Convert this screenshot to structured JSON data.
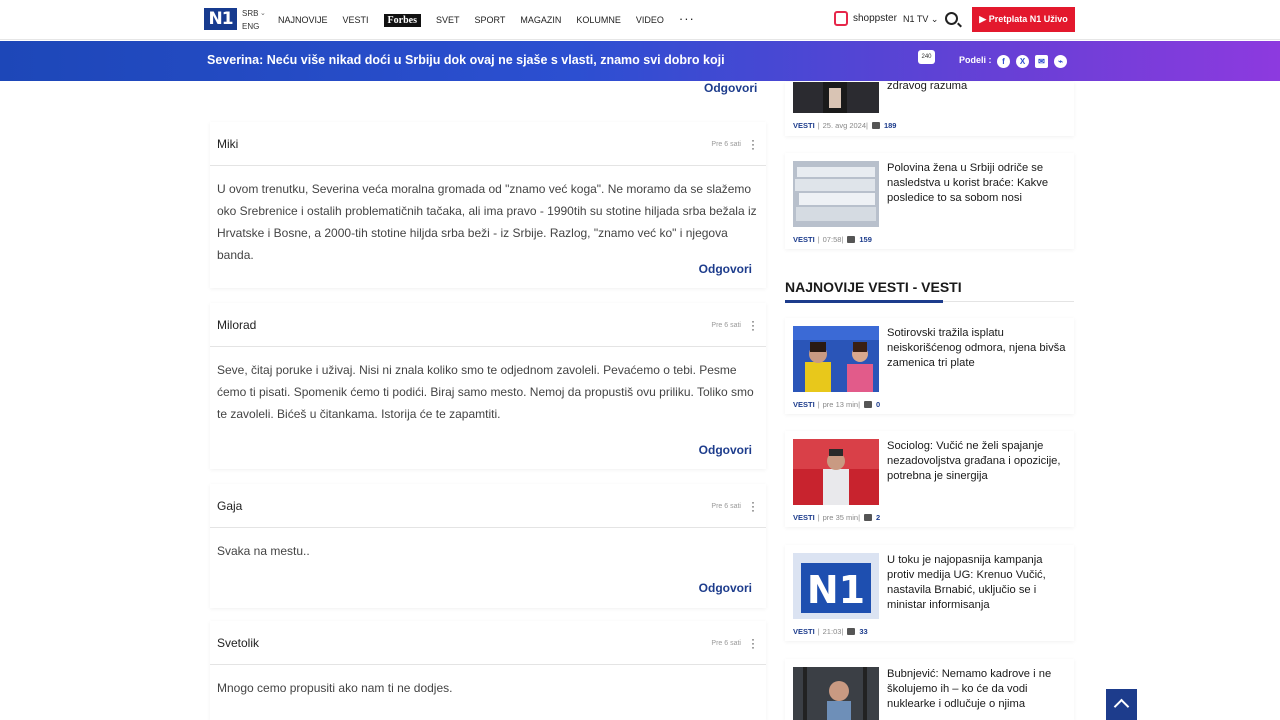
{
  "nav": {
    "logo": "N1",
    "lang_active": "SRB",
    "lang_alt": "ENG",
    "links": [
      "NAJNOVIJE",
      "VESTI",
      "Forbes",
      "SVET",
      "SPORT",
      "MAGAZIN",
      "KOLUMNE",
      "VIDEO",
      "···"
    ],
    "shopster": "shoppster",
    "n1tv": "N1 TV",
    "live_button": "Pretplata N1 Uživo"
  },
  "banner": {
    "title": "Severina: Neću više nikad doći u Srbiju dok ovaj ne sjaše s vlasti, znamo svi dobro koji",
    "comment_badge": "240",
    "share_label": "Podeli :",
    "share_icons": [
      "f",
      "✆",
      "X",
      "✉",
      "⌁"
    ]
  },
  "comments": [
    {
      "author": "Miki",
      "time": "Pre 6 sati",
      "text": "U ovom trenutku, Severina veća moralna gromada od \"znamo već koga\". Ne moramo da se slažemo oko Srebrenice i ostalih problematičnih tačaka, ali ima pravo - 1990tih su stotine hiljada srba bežala iz Hrvatske i Bosne, a 2000-tih stotine hiljda srba beži - iz Srbije. Razlog, \"znamo već ko\" i njegova banda.",
      "reply": "Odgovori"
    },
    {
      "author": "Milorad",
      "time": "Pre 6 sati",
      "text": "Seve, čitaj poruke i uživaj. Nisi ni znala koliko smo te odjednom zavoleli. Pevaćemo o tebi. Pesme ćemo ti pisati. Spomenik ćemo ti podići. Biraj samo mesto. Nemoj da propustiš ovu priliku. Toliko smo te zavoleli. Bićeš u čitankama. Istorija će te zapamtiti.",
      "reply": "Odgovori"
    },
    {
      "author": "Gaja",
      "time": "Pre 6 sati",
      "text": "Svaka na mestu..",
      "reply": "Odgovori"
    },
    {
      "author": "Svetolik",
      "time": "Pre 6 sati",
      "text": "Mnogo cemo propusiti ako nam ti ne dodjes.",
      "reply": "Odgovori"
    }
  ],
  "top_reply": "Odgovori",
  "sidebar": {
    "top_cards": [
      {
        "title": "zdravog razuma",
        "category": "VESTI",
        "time": "25. avg 2024",
        "comments": "189"
      },
      {
        "title": "Polovina žena u Srbiji odriče se nasledstva u korist braće: Kakve posledice to sa sobom nosi",
        "category": "VESTI",
        "time": "07:58",
        "comments": "159"
      }
    ],
    "section_title": "NAJNOVIJE VESTI - VESTI",
    "cards": [
      {
        "title": "Sotirovski tražila isplatu neiskorišćenog odmora, njena bivša zamenica tri plate",
        "category": "VESTI",
        "time": "pre 13 min",
        "comments": "0"
      },
      {
        "title": "Sociolog: Vučić ne želi spajanje nezadovoljstva građana i opozicije, potrebna je sinergija",
        "category": "VESTI",
        "time": "pre 35 min",
        "comments": "2"
      },
      {
        "title": "U toku je najopasnija kampanja protiv medija UG: Krenuo Vučić, nastavila Brnabić, uključio se i ministar informisanja",
        "category": "VESTI",
        "time": "21:03",
        "comments": "33"
      },
      {
        "title": "Bubnjević: Nemamo kadrove i ne školujemo ih – ko će da vodi nuklearke i odlučuje o njima",
        "category": "VESTI",
        "time": "",
        "comments": ""
      }
    ]
  },
  "colors": {
    "brand_blue": "#1d3c8c",
    "live_red": "#e3182d",
    "banner_start": "#1d47b8",
    "banner_end": "#8d3adf"
  }
}
